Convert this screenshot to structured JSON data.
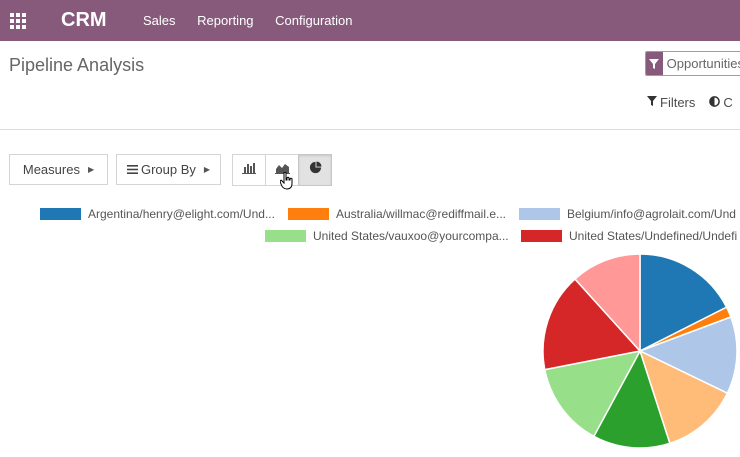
{
  "topbar": {
    "app_name": "CRM",
    "menu": [
      "Sales",
      "Reporting",
      "Configuration"
    ]
  },
  "page": {
    "title": "Pipeline Analysis"
  },
  "search": {
    "facet_label": "Opportunities"
  },
  "control_panel": {
    "filters_label": "Filters",
    "compare_label": "C"
  },
  "toolbar": {
    "measures_label": "Measures",
    "group_by_label": "Group By",
    "modes": [
      "bar-chart-icon",
      "line-chart-icon",
      "pie-chart-icon"
    ],
    "active_mode": "pie-chart-icon"
  },
  "chart_data": {
    "type": "pie",
    "legend": [
      {
        "label": "Argentina/henry@elight.com/Und...",
        "color": "#1f77b4"
      },
      {
        "label": "Australia/willmac@rediffmail.e...",
        "color": "#ff7f0e"
      },
      {
        "label": "Belgium/info@agrolait.com/Und",
        "color": "#aec7e8"
      },
      {
        "label": "United States/vauxoo@yourcompa...",
        "color": "#98df8a"
      },
      {
        "label": "United States/Undefined/Undefi",
        "color": "#d62728"
      }
    ],
    "slices": [
      {
        "color": "#1f77b4",
        "value": 15
      },
      {
        "color": "#ff7f0e",
        "value": 1.5
      },
      {
        "color": "#aec7e8",
        "value": 11
      },
      {
        "color": "#ffbb78",
        "value": 11
      },
      {
        "color": "#2ca02c",
        "value": 11
      },
      {
        "color": "#98df8a",
        "value": 12
      },
      {
        "color": "#d62728",
        "value": 14
      },
      {
        "color": "#ff9896",
        "value": 10
      }
    ]
  }
}
